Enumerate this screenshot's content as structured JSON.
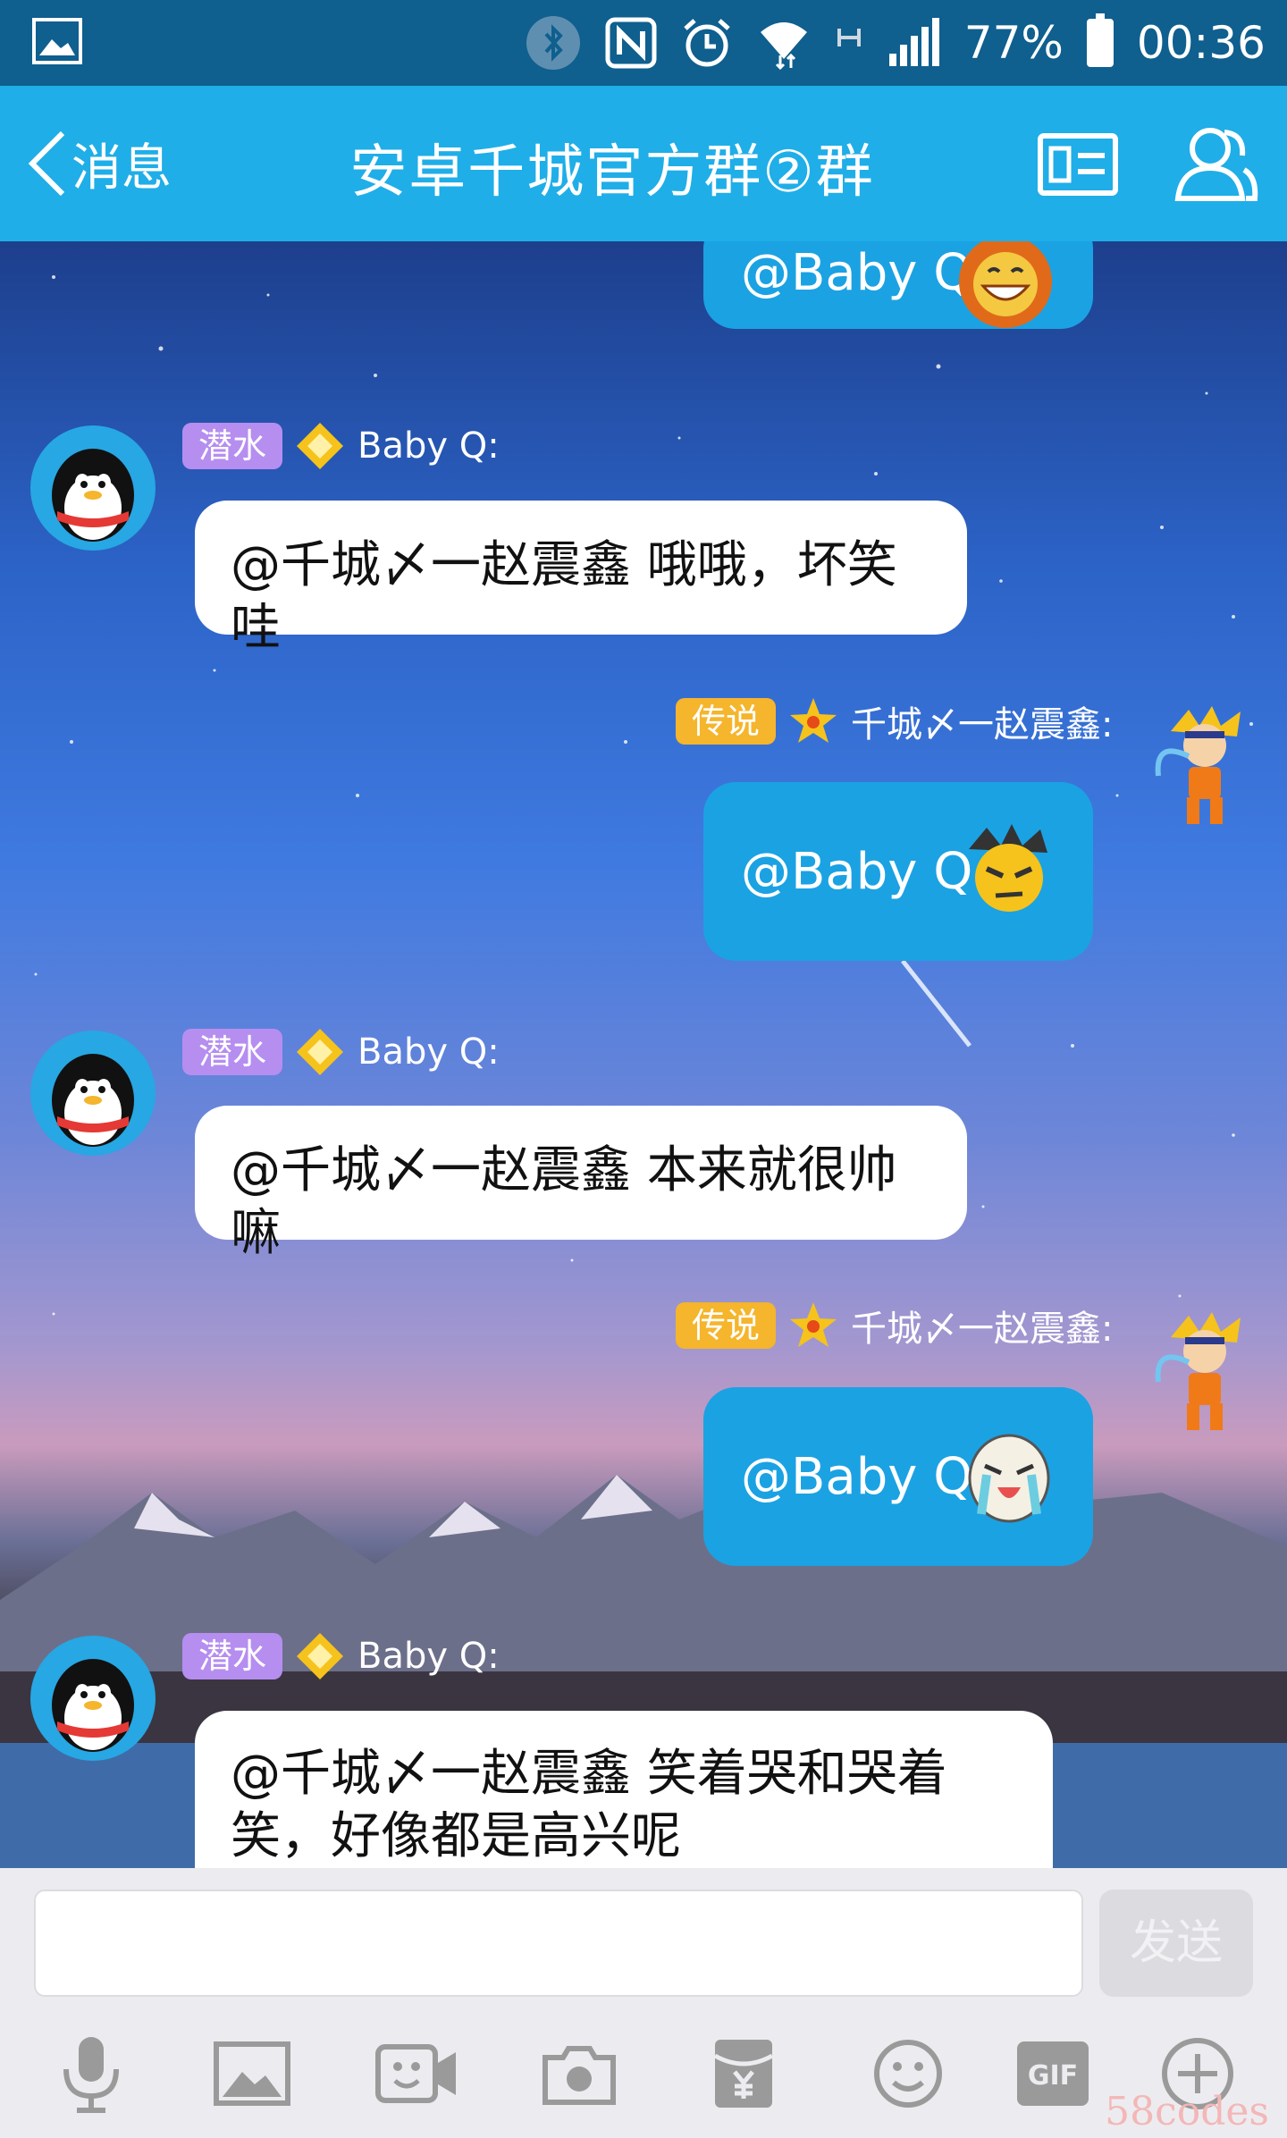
{
  "status_bar": {
    "battery": "77%",
    "time": "00:36"
  },
  "header": {
    "back_label": "消息",
    "title": "安卓千城官方群②群"
  },
  "messages": [
    {
      "type": "out",
      "text": "@Baby Q"
    },
    {
      "type": "in",
      "badge": "潜水",
      "sender": "Baby Q:",
      "text": "@千城〆一赵震鑫 哦哦，坏笑哇"
    },
    {
      "type": "out",
      "badge": "传说",
      "sender": "千城〆一赵震鑫:",
      "text": "@Baby Q"
    },
    {
      "type": "in",
      "badge": "潜水",
      "sender": "Baby Q:",
      "text": "@千城〆一赵震鑫 本来就很帅嘛"
    },
    {
      "type": "out",
      "badge": "传说",
      "sender": "千城〆一赵震鑫:",
      "text": "@Baby Q"
    },
    {
      "type": "in",
      "badge": "潜水",
      "sender": "Baby Q:",
      "text_line1": "@千城〆一赵震鑫 笑着哭和哭着",
      "text_line2": "笑，好像都是高兴呢"
    }
  ],
  "input": {
    "placeholder": "",
    "send_label": "发送"
  },
  "toolbar": {
    "gif_label": "GIF"
  },
  "watermark": "58codes",
  "colors": {
    "status_bar": "#0f5f8f",
    "title_bar": "#1faee8",
    "out_bubble": "#1ba2e3",
    "badge_diving": "#b58ef0",
    "badge_legend": "#f5b52c"
  }
}
